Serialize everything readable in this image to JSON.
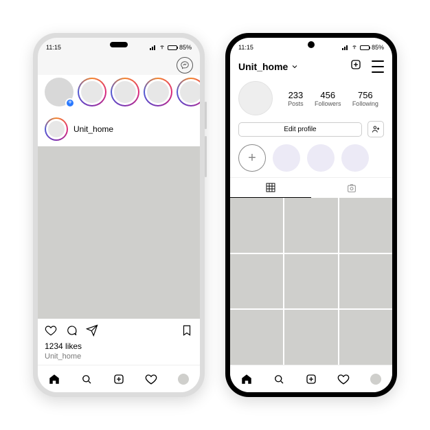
{
  "status": {
    "time": "11:15",
    "battery": "85%"
  },
  "feed": {
    "username": "Unit_home",
    "likes_line": "1234 likes",
    "caption_user": "Unit_home"
  },
  "profile": {
    "username": "Unit_home",
    "stats": {
      "posts": {
        "n": "233",
        "label": "Posts"
      },
      "followers": {
        "n": "456",
        "label": "Followers"
      },
      "following": {
        "n": "756",
        "label": "Following"
      }
    },
    "edit_label": "Edit profile"
  }
}
